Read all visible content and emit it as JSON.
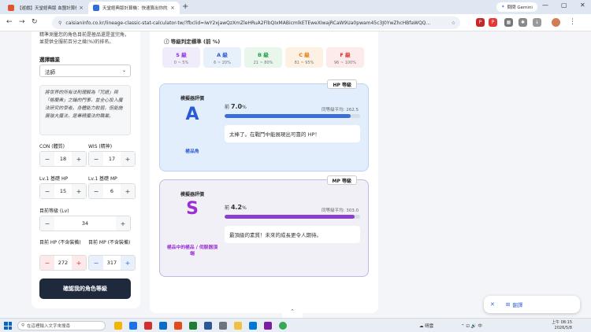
{
  "browser": {
    "tabs": [
      {
        "title": "【遊戲】天堂經典版 血盟計算機 會員",
        "active": false
      },
      {
        "title": "天堂經典版計算機：快速算出你的屬",
        "active": true
      }
    ],
    "gemini_label": "問問 Gemini",
    "url": "caisianinfo.co.kr/lineage-classic-stat-calculator-tw/?fbclid=IwY2xjawQzXmZleHRuA2FlbQIxMABicmlkETEweXIwajRCaW9Ua0pwam45c3J0YwZhcHBfaWQQ..."
  },
  "form": {
    "description": "精準測量您的角色目前是極品還是蓝完角，並提供全服前百分之幾(%)的排名。",
    "job_label": "選擇職業",
    "job_value": "法師",
    "quote": "將世界的所有法則理解為「咒語」與「格蘭弗」之鑰的門事，並全心投入魔法研究的學者。身體能力較弱，但能施展強大魔法，是專精魔法的職業。",
    "con_label": "CON (體質)",
    "con_value": "18",
    "wis_label": "WIS (精神)",
    "wis_value": "17",
    "base_hp_label": "Lv.1 基礎 HP",
    "base_hp_value": "15",
    "base_mp_label": "Lv.1 基礎 MP",
    "base_mp_value": "6",
    "level_label": "目前等級 (Lv)",
    "level_value": "34",
    "cur_hp_label": "目前 HP (不含裝備)",
    "cur_hp_value": "272",
    "cur_mp_label": "目前 MP (不含裝備)",
    "cur_mp_value": "317",
    "minus": "−",
    "plus": "+",
    "confirm_label": "確認我的角色等級"
  },
  "standards": {
    "title": "等級判定標準 (前 %)",
    "grades": [
      {
        "grade": "S 級",
        "range": "0 ~ 5%",
        "bg": "#f1ecfb",
        "color": "#8a2be2"
      },
      {
        "grade": "A 級",
        "range": "6 ~ 20%",
        "bg": "#e8f0fc",
        "color": "#2a5bd7"
      },
      {
        "grade": "B 級",
        "range": "21 ~ 80%",
        "bg": "#e9f6ec",
        "color": "#1f9d48"
      },
      {
        "grade": "C 級",
        "range": "81 ~ 95%",
        "bg": "#fdf1e3",
        "color": "#e07b12"
      },
      {
        "grade": "F 級",
        "range": "96 ~ 100%",
        "bg": "#fdeaea",
        "color": "#d93030"
      }
    ]
  },
  "hp_result": {
    "tag": "HP 等級",
    "eval_label": "模擬器評價",
    "grade": "A",
    "grade_color": "#2a5bd7",
    "desc": "極品角",
    "top_prefix": "前",
    "top_pct": "7.0",
    "pct_sign": "%",
    "avg": "同等級平均: 262.5",
    "progress": 93,
    "bar_color": "#3b6fd6",
    "comment": "太棒了。在戰鬥中能展現出可靠的 HP！"
  },
  "mp_result": {
    "tag": "MP 等級",
    "eval_label": "模擬器評價",
    "grade": "S",
    "grade_color": "#9b2fd6",
    "desc": "極品中的極品 / 伺服器頂端",
    "top_prefix": "前",
    "top_pct": "4.2",
    "pct_sign": "%",
    "avg": "同等級平均: 303.0",
    "progress": 96,
    "bar_color": "#8b3fd0",
    "comment": "最頂級的素質！未來的成長更令人期待。"
  },
  "translate_label": "翻譯",
  "taskbar": {
    "search_placeholder": "在這裡輸入文字來搜尋",
    "weather": "晴雲",
    "tray_lang": "中",
    "time": "上午 08:15",
    "date": "2026/5/8"
  }
}
